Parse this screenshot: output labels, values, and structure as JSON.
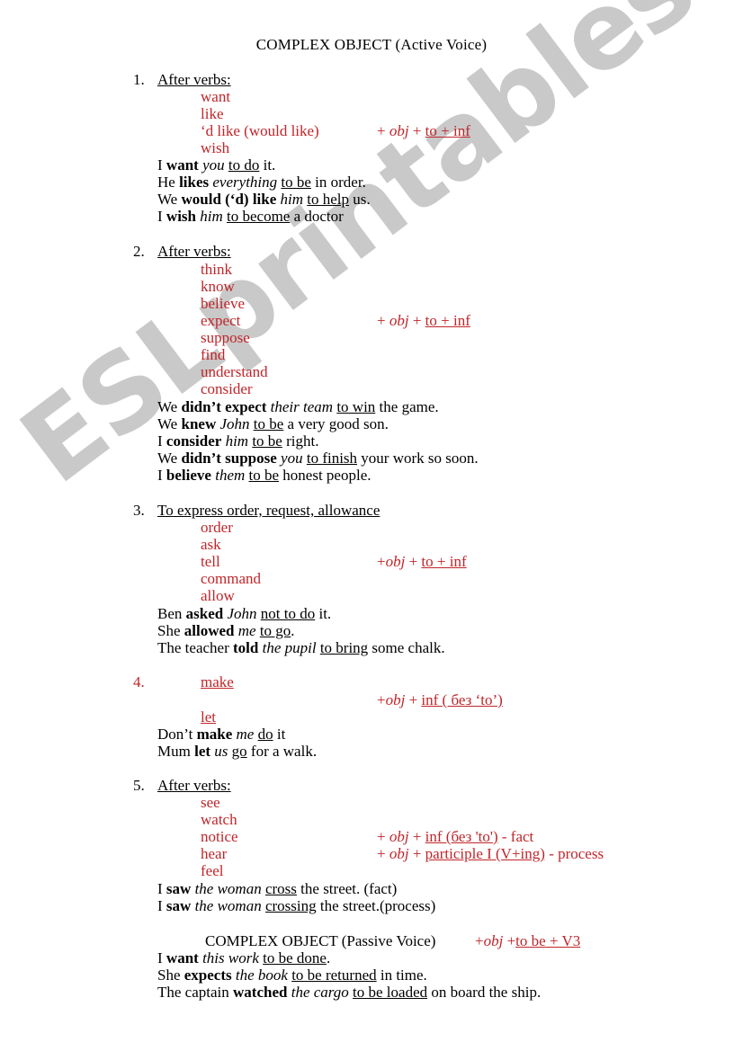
{
  "document": {
    "title": "COMPLEX OBJECT (Active Voice)",
    "watermark": "ESLprintables.com",
    "accent_color": "#c0252a",
    "watermark_color": "#c9c9c9"
  },
  "sections": [
    {
      "number": "1.",
      "heading": "After verbs:",
      "verbs": [
        "want",
        "like",
        "‘d like (would like)",
        "wish"
      ],
      "formula": "+ obj + to + inf",
      "formula_parts": {
        "prefix": "+ ",
        "obj": "obj",
        "mid": " + ",
        "underlined": "to + inf",
        "suffix": ""
      },
      "examples": [
        {
          "plain1": "I ",
          "bold": "want",
          "italic": " you ",
          "underline": "to do",
          "plain2": " it."
        },
        {
          "plain1": "He ",
          "bold": "likes",
          "italic": " everything ",
          "underline": "to be",
          "plain2": " in order."
        },
        {
          "plain1": "We ",
          "bold": "would (‘d) like",
          "italic": " him ",
          "underline": "to help",
          "plain2": " us."
        },
        {
          "plain1": "I ",
          "bold": "wish",
          "italic": " him ",
          "underline": "to become",
          "plain2": " a doctor"
        }
      ]
    },
    {
      "number": "2.",
      "heading": "After verbs:",
      "verbs": [
        "think",
        "know",
        "believe",
        "expect",
        "suppose",
        "find",
        "understand",
        "consider"
      ],
      "formula": "+ obj + to + inf",
      "formula_parts": {
        "prefix": "+ ",
        "obj": "obj",
        "mid": " + ",
        "underlined": "to + inf",
        "suffix": ""
      },
      "examples": [
        {
          "plain1": "We ",
          "bold": "didn’t expect",
          "italic": " their team ",
          "underline": "to win",
          "plain2": " the game."
        },
        {
          "plain1": "We ",
          "bold": "knew",
          "italic": " John ",
          "underline": "to be",
          "plain2": " a very good son."
        },
        {
          "plain1": "I ",
          "bold": "consider",
          "italic": " him ",
          "underline": "to be",
          "plain2": " right."
        },
        {
          "plain1": "We ",
          "bold": "didn’t suppose",
          "italic": " you ",
          "underline": "to finish",
          "plain2": " your work so soon."
        },
        {
          "plain1": "I ",
          "bold": "believe",
          "italic": " them ",
          "underline": "to be",
          "plain2": " honest people."
        }
      ]
    },
    {
      "number": "3.",
      "heading": "To express order, request, allowance",
      "verbs": [
        "order",
        "ask",
        "tell",
        "command",
        "allow"
      ],
      "formula": "+obj + to + inf",
      "formula_parts": {
        "prefix": "+",
        "obj": "obj",
        "mid": " + ",
        "underlined": "to + inf",
        "suffix": ""
      },
      "examples": [
        {
          "plain1": "Ben ",
          "bold": "asked",
          "italic": " John ",
          "underline": "not to do",
          "plain2": " it."
        },
        {
          "plain1": "She ",
          "bold": "allowed",
          "italic": " me ",
          "underline": "to go",
          "plain2": "."
        },
        {
          "plain1": "The teacher ",
          "bold": "told",
          "italic": " the pupil ",
          "underline": "to bring",
          "plain2": " some chalk."
        }
      ]
    },
    {
      "number": "4.",
      "heading": "",
      "verbs": [
        "make",
        "let"
      ],
      "formula": "+obj + inf ( без ‘to’)",
      "formula_parts": {
        "prefix": "+",
        "obj": "obj",
        "mid": " + ",
        "underlined": "inf ( без ‘to’)",
        "suffix": ""
      },
      "examples": [
        {
          "plain1": "Don’t ",
          "bold": "make",
          "italic": " me ",
          "underline": "do",
          "plain2": " it"
        },
        {
          "plain1": "Mum ",
          "bold": "let",
          "italic": " us ",
          "underline": "go",
          "plain2": " for a walk."
        }
      ]
    },
    {
      "number": "5.",
      "heading": "After verbs:",
      "verbs": [
        "see",
        "watch",
        "notice",
        "hear",
        "feel"
      ],
      "formula_fact": {
        "prefix": "+ ",
        "obj": "obj",
        "mid": " + ",
        "underlined": "inf (без 'to')",
        "suffix": "   - fact"
      },
      "formula_process": {
        "prefix": "+ ",
        "obj": "obj",
        "mid": " + ",
        "underlined": "participle I (V+ing)",
        "suffix": " - process"
      },
      "examples": [
        {
          "plain1": "I ",
          "bold": "saw",
          "italic": " the woman ",
          "underline": "cross",
          "plain2": " the street. (fact)"
        },
        {
          "plain1": "I ",
          "bold": "saw",
          "italic": " the woman ",
          "underline": "crossing",
          "plain2": " the street.(process)"
        }
      ]
    }
  ],
  "passive": {
    "title": "COMPLEX OBJECT (Passive Voice)",
    "formula_parts": {
      "prefix": "+",
      "obj": "obj",
      "mid": " +",
      "underlined": "to be + V3",
      "suffix": ""
    },
    "examples": [
      {
        "plain1": "I ",
        "bold": "want",
        "italic": " this work ",
        "underline": "to be done",
        "plain2": "."
      },
      {
        "plain1": "She ",
        "bold": "expects",
        "italic": " the book ",
        "underline": "to be returned",
        "plain2": " in time."
      },
      {
        "plain1": "The captain ",
        "bold": "watched",
        "italic": " the cargo ",
        "underline": "to be loaded",
        "plain2": " on board the ship."
      }
    ]
  }
}
